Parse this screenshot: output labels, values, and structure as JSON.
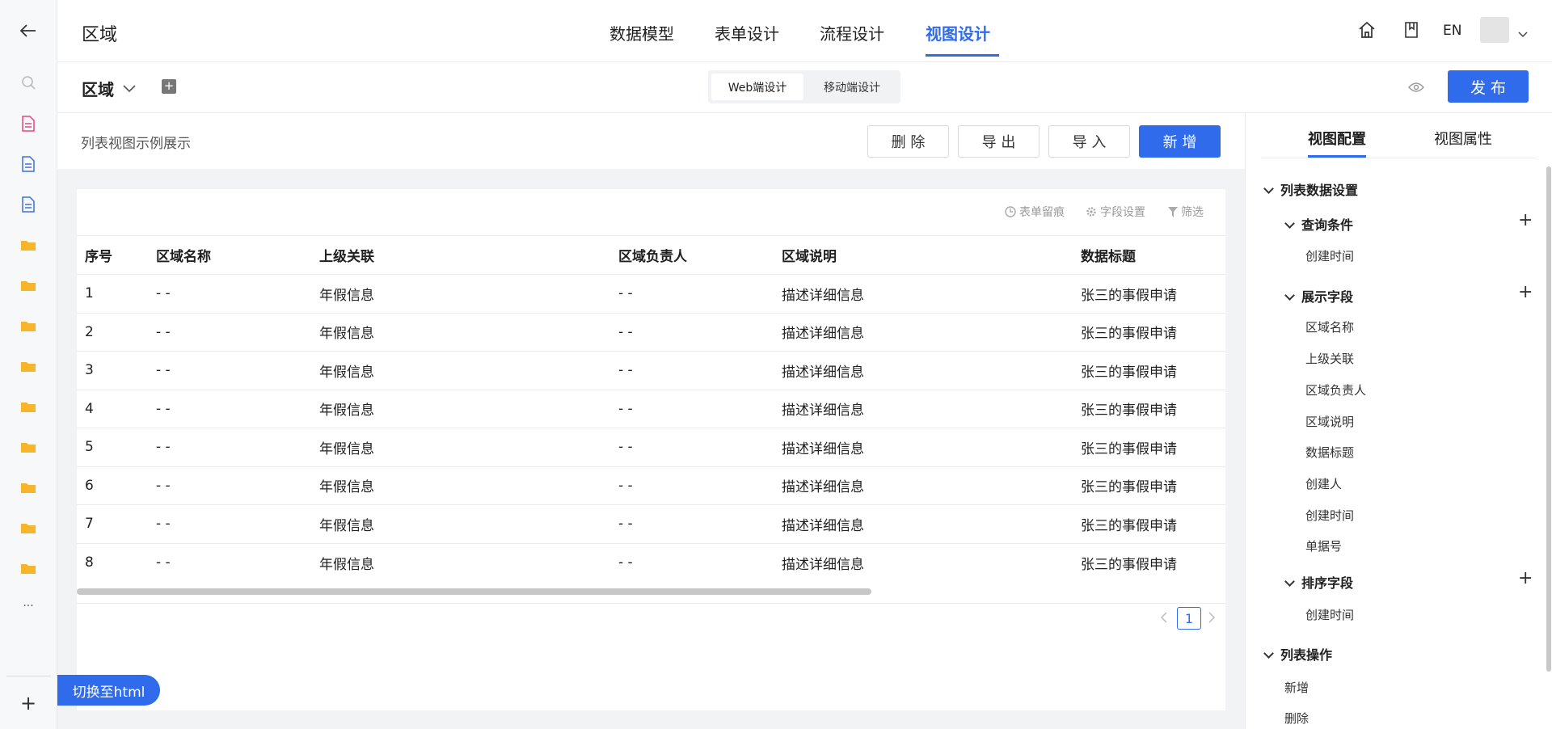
{
  "rail": {
    "more": "...",
    "add": "+"
  },
  "topbar": {
    "title": "区域",
    "tabs": [
      "数据模型",
      "表单设计",
      "流程设计",
      "视图设计"
    ],
    "lang": "EN"
  },
  "subbar": {
    "title": "区域",
    "seg": [
      "Web端设计",
      "移动端设计"
    ],
    "publish": "发 布"
  },
  "main": {
    "caption": "列表视图示例展示",
    "buttons": {
      "delete": "删 除",
      "export": "导 出",
      "import": "导 入",
      "add": "新 增"
    },
    "tools": {
      "history": "表单留痕",
      "fields": "字段设置",
      "filter": "筛选"
    },
    "columns": [
      "序号",
      "区域名称",
      "上级关联",
      "区域负责人",
      "区域说明",
      "数据标题"
    ],
    "rows": [
      [
        "1",
        "- -",
        "年假信息",
        "- -",
        "描述详细信息",
        "张三的事假申请"
      ],
      [
        "2",
        "- -",
        "年假信息",
        "- -",
        "描述详细信息",
        "张三的事假申请"
      ],
      [
        "3",
        "- -",
        "年假信息",
        "- -",
        "描述详细信息",
        "张三的事假申请"
      ],
      [
        "4",
        "- -",
        "年假信息",
        "- -",
        "描述详细信息",
        "张三的事假申请"
      ],
      [
        "5",
        "- -",
        "年假信息",
        "- -",
        "描述详细信息",
        "张三的事假申请"
      ],
      [
        "6",
        "- -",
        "年假信息",
        "- -",
        "描述详细信息",
        "张三的事假申请"
      ],
      [
        "7",
        "- -",
        "年假信息",
        "- -",
        "描述详细信息",
        "张三的事假申请"
      ],
      [
        "8",
        "- -",
        "年假信息",
        "- -",
        "描述详细信息",
        "张三的事假申请"
      ]
    ],
    "page": "1",
    "switch_html": "切换至html"
  },
  "rpanel": {
    "tabs": [
      "视图配置",
      "视图属性"
    ],
    "sec_list": "列表数据设置",
    "sec_query": "查询条件",
    "query_items": [
      "创建时间"
    ],
    "sec_display": "展示字段",
    "display_items": [
      "区域名称",
      "上级关联",
      "区域负责人",
      "区域说明",
      "数据标题",
      "创建人",
      "创建时间",
      "单据号"
    ],
    "sec_sort": "排序字段",
    "sort_items": [
      "创建时间"
    ],
    "sec_ops": "列表操作",
    "op_items": [
      "新增",
      "删除"
    ]
  },
  "colors": {
    "accent": "#2f6bea",
    "folder": "#f7b52c",
    "doc_red": "#e8457a",
    "doc_blue": "#3d6fe0"
  }
}
